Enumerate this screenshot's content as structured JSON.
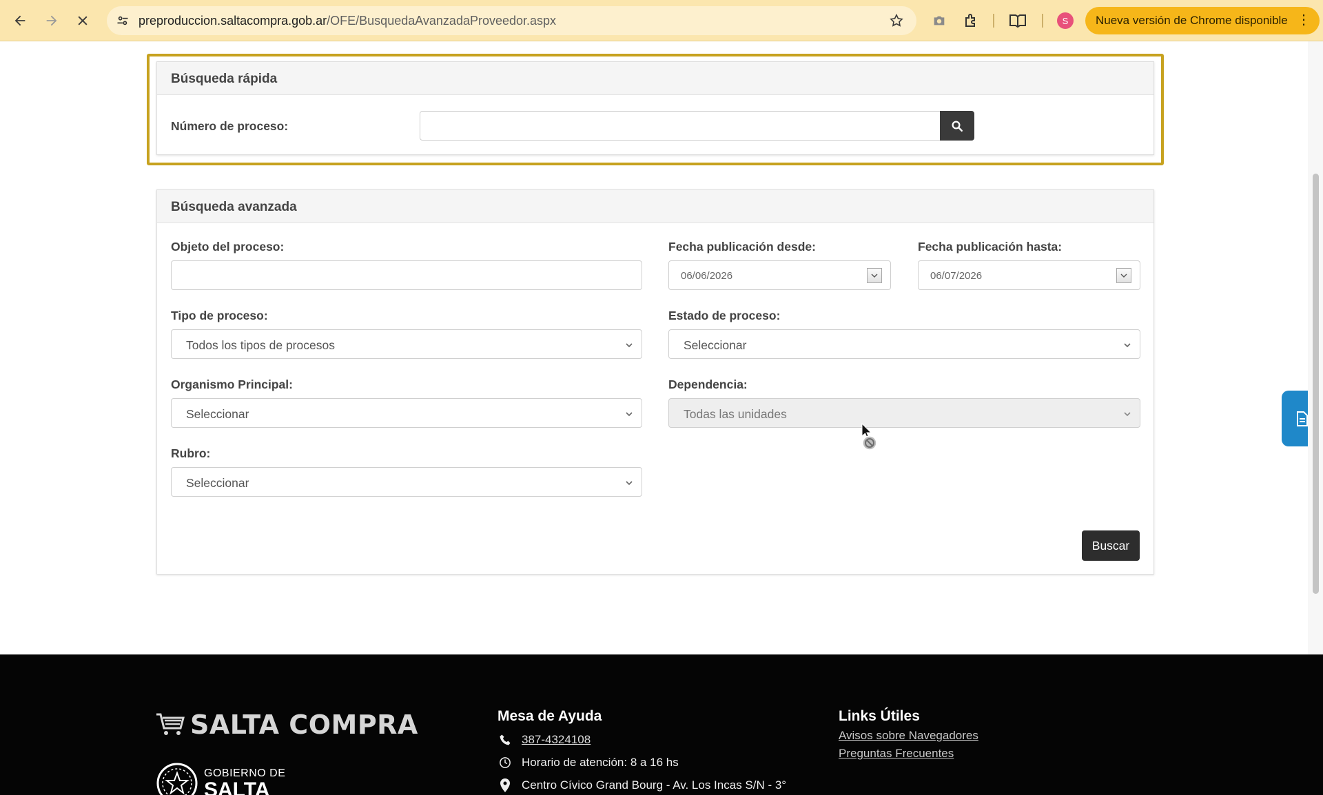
{
  "browser": {
    "url_host": "preproduccion.saltacompra.gob.ar",
    "url_path": "/OFE/BusquedaAvanzadaProveedor.aspx",
    "profile_initial": "S",
    "update_label": "Nueva versión de Chrome disponible",
    "icons": [
      "back-arrow-icon",
      "forward-arrow-icon",
      "stop-loading-icon",
      "site-info-icon",
      "bookmark-star-icon",
      "camera-icon",
      "extensions-icon",
      "reading-list-icon",
      "more-menu-icon"
    ]
  },
  "quick_search": {
    "title": "Búsqueda rápida",
    "process_number_label": "Número de proceso:",
    "process_number_value": ""
  },
  "advanced_search": {
    "title": "Búsqueda avanzada",
    "object_label": "Objeto del proceso:",
    "object_value": "",
    "date_from_label": "Fecha publicación desde:",
    "date_from_value": "06/06/2026",
    "date_to_label": "Fecha publicación hasta:",
    "date_to_value": "06/07/2026",
    "process_type_label": "Tipo de proceso:",
    "process_type_value": "Todos los tipos de procesos",
    "process_state_label": "Estado de proceso:",
    "process_state_value": "Seleccionar",
    "main_org_label": "Organismo Principal:",
    "main_org_value": "Seleccionar",
    "dependency_label": "Dependencia:",
    "dependency_value": "Todas las unidades",
    "category_label": "Rubro:",
    "category_value": "Seleccionar",
    "search_button": "Buscar"
  },
  "footer": {
    "brand": "SALTA COMPRA",
    "gov_line1": "GOBIERNO DE",
    "gov_line2": "SALTA",
    "help_title": "Mesa de Ayuda",
    "phone": "387-4324108",
    "hours": "Horario de atención: 8 a 16 hs",
    "address": "Centro Cívico Grand Bourg - Av. Los Incas S/N - 3°",
    "links_title": "Links Útiles",
    "links": [
      "Avisos sobre Navegadores",
      "Preguntas Frecuentes"
    ]
  },
  "colors": {
    "chrome_bar": "#fbe6ae",
    "update_pill": "#f6b619",
    "highlight_frame": "#c7a21f",
    "dark_button": "#2d2d2d",
    "side_tab": "#1f88c9",
    "footer_bg": "#050505"
  }
}
